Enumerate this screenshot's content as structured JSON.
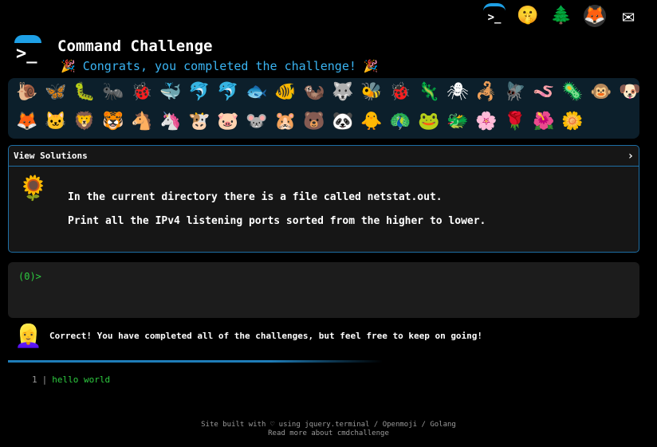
{
  "header": {
    "title": "Command Challenge",
    "congrats_prefix_emoji": "🎉",
    "congrats": "Congrats, you completed the challenge!",
    "congrats_suffix_emoji": "🎉",
    "logo_glyph": ">_"
  },
  "topbar": {
    "icons": [
      {
        "name": "command-challenge-icon",
        "glyph": ">_"
      },
      {
        "name": "shushing-face-icon",
        "glyph": "🤫"
      },
      {
        "name": "tree-icon",
        "glyph": "🌲"
      },
      {
        "name": "gitlab-icon",
        "glyph": "🦊"
      },
      {
        "name": "envelope-icon",
        "glyph": "✉"
      }
    ]
  },
  "emojis": {
    "row1": [
      "🐌",
      "🦋",
      "🐛",
      "🐜",
      "🐞",
      "🐳",
      "🐬",
      "🐬",
      "🐟",
      "🐠",
      "🦦",
      "🐺",
      "🐝",
      "🐞",
      "🦎",
      "🕷",
      "🦂",
      "🪰",
      "🪱",
      "🦠",
      "🐵",
      "🐶"
    ],
    "row2": [
      "🦊",
      "🐱",
      "🦁",
      "🐯",
      "🐴",
      "🦄",
      "🐮",
      "🐷",
      "🐭",
      "🐹",
      "🐻",
      "🐼",
      "🐥",
      "🦚",
      "🐸",
      "🐲",
      "🌸",
      "🌹",
      "🌺",
      "🌼"
    ]
  },
  "solutions": {
    "label": "View Solutions",
    "chevron": "›",
    "task_icon": "🌻",
    "task_line1": "In the current directory there is a file called netstat.out.",
    "task_line2": "Print all the IPv4 listening ports sorted from the higher to lower."
  },
  "terminal": {
    "prompt": "(0)>"
  },
  "result": {
    "person_icon": "👱‍♀️",
    "message": "Correct! You have completed all of the challenges, but feel free to keep on going!"
  },
  "output": {
    "line_number": "1",
    "separator": "|",
    "text": "hello world"
  },
  "footer": {
    "line1": "Site built with ♡ using jquery.terminal / Openmoji / Golang",
    "line2": "Read more about cmdchallenge"
  },
  "colors": {
    "accent": "#1ea0e6",
    "congrats": "#3ab4f2",
    "prompt_green": "#2ecc40",
    "panel_bg": "#0c1f2b"
  }
}
